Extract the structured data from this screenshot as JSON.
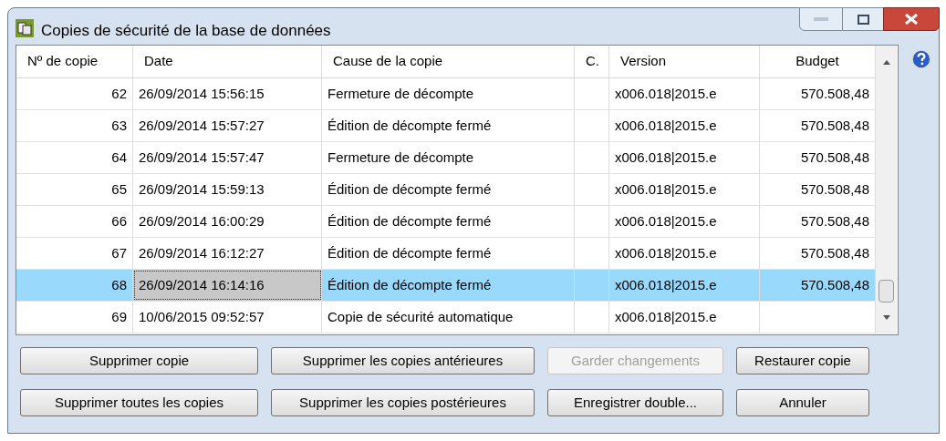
{
  "window": {
    "title": "Copies de sécurité de la base de données"
  },
  "table": {
    "columns": [
      "Nº de copie",
      "Date",
      "Cause de la copie",
      "C.",
      "Version",
      "Budget"
    ],
    "rows": [
      {
        "cells": [
          "62",
          "26/09/2014 15:56:15",
          "Fermeture de décompte",
          "",
          "x006.018|2015.e",
          "570.508,48"
        ],
        "selected": false
      },
      {
        "cells": [
          "63",
          "26/09/2014 15:57:27",
          "Édition de décompte fermé",
          "",
          "x006.018|2015.e",
          "570.508,48"
        ],
        "selected": false
      },
      {
        "cells": [
          "64",
          "26/09/2014 15:57:47",
          "Fermeture de décompte",
          "",
          "x006.018|2015.e",
          "570.508,48"
        ],
        "selected": false
      },
      {
        "cells": [
          "65",
          "26/09/2014 15:59:13",
          "Édition de décompte fermé",
          "",
          "x006.018|2015.e",
          "570.508,48"
        ],
        "selected": false
      },
      {
        "cells": [
          "66",
          "26/09/2014 16:00:29",
          "Édition de décompte fermé",
          "",
          "x006.018|2015.e",
          "570.508,48"
        ],
        "selected": false
      },
      {
        "cells": [
          "67",
          "26/09/2014 16:12:27",
          "Édition de décompte fermé",
          "",
          "x006.018|2015.e",
          "570.508,48"
        ],
        "selected": false
      },
      {
        "cells": [
          "68",
          "26/09/2014 16:14:16",
          "Édition de décompte fermé",
          "",
          "x006.018|2015.e",
          "570.508,48"
        ],
        "selected": true
      },
      {
        "cells": [
          "69",
          "10/06/2015 09:52:57",
          "Copie de sécurité automatique",
          "",
          "x006.018|2015.e",
          ""
        ],
        "selected": false
      }
    ]
  },
  "buttons": [
    {
      "label": "Supprimer copie",
      "disabled": false
    },
    {
      "label": "Supprimer les copies antérieures",
      "disabled": false
    },
    {
      "label": "Garder changements",
      "disabled": true
    },
    {
      "label": "Restaurer copie",
      "disabled": false
    },
    {
      "label": "Supprimer toutes les copies",
      "disabled": false
    },
    {
      "label": "Supprimer les copies postérieures",
      "disabled": false
    },
    {
      "label": "Enregistrer double...",
      "disabled": false
    },
    {
      "label": "Annuler",
      "disabled": false
    }
  ]
}
